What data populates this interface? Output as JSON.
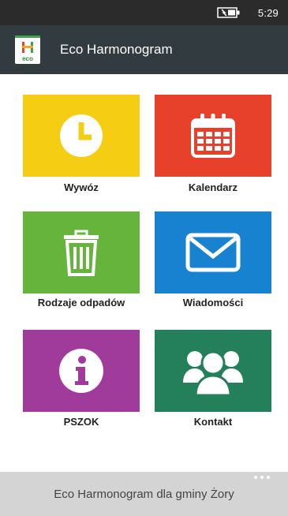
{
  "status_bar": {
    "time": "5:29",
    "battery_icon": "battery-charging-icon"
  },
  "app_bar": {
    "title": "Eco Harmonogram",
    "logo_text": "eco",
    "logo_icon": "eco-logo-icon"
  },
  "tiles": [
    {
      "label": "Wywóz",
      "color": "#f5cd12",
      "icon": "clock-icon"
    },
    {
      "label": "Kalendarz",
      "color": "#e8412b",
      "icon": "calendar-icon"
    },
    {
      "label": "Rodzaje odpadów",
      "color": "#66b43c",
      "icon": "trash-icon"
    },
    {
      "label": "Wiadomości",
      "color": "#1782cf",
      "icon": "envelope-icon"
    },
    {
      "label": "PSZOK",
      "color": "#a13b9b",
      "icon": "info-icon"
    },
    {
      "label": "Kontakt",
      "color": "#23805a",
      "icon": "people-icon"
    }
  ],
  "bottom_bar": {
    "text": "Eco Harmonogram dla gminy Żory",
    "more_icon": "more-dots-icon"
  }
}
